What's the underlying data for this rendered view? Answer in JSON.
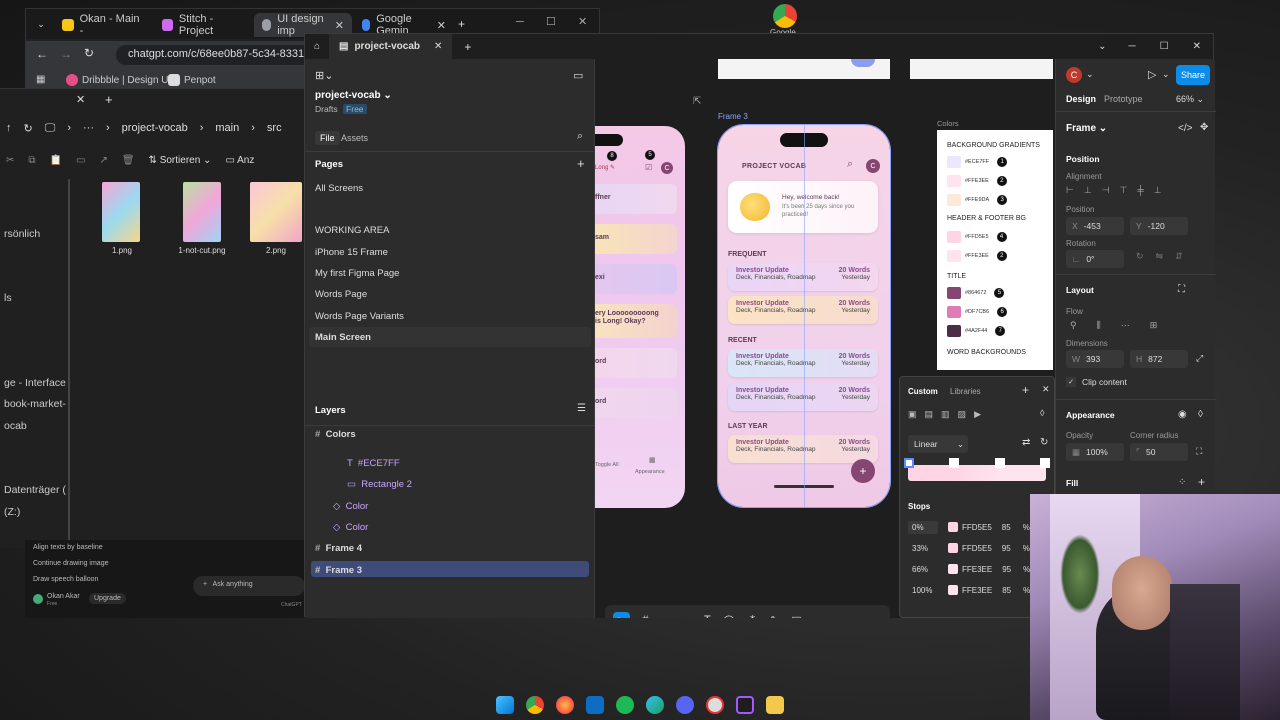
{
  "chrome": {
    "tabs": [
      "Okan - Main -",
      "Stitch - Project",
      "UI design imp",
      "Google Gemin"
    ],
    "url": "chatgpt.com/c/68ee0b87-5c34-8331-9691",
    "bookmarks": [
      "Dribbble | Design U...",
      "Penpot"
    ]
  },
  "desktop": {
    "chrome_label": "Google"
  },
  "explorer": {
    "breadcrumb": [
      "project-vocab",
      "main",
      "src"
    ],
    "sort_label": "Sortieren",
    "view_label": "Anz",
    "files": [
      "1.png",
      "1-not-cut.png",
      "2.png"
    ],
    "sidebar": [
      "rsönlich",
      "ls",
      "ge - Interface D",
      "book-market-a",
      "ocab",
      "Datenträger (C:)",
      "(Z:)"
    ]
  },
  "chatgpt": {
    "items": [
      "Align texts by baseline",
      "Continue drawing image",
      "Draw speech balloon"
    ],
    "user": "Okan Akar",
    "plan": "Free",
    "upgrade": "Upgrade",
    "ask": "Ask anything",
    "brand": "ChatGPT"
  },
  "figma": {
    "tab": "project-vocab",
    "project": {
      "name": "project-vocab",
      "location": "Drafts",
      "badge": "Free"
    },
    "panel_tabs": [
      "File",
      "Assets"
    ],
    "pages_label": "Pages",
    "pages": [
      "All Screens",
      "WORKING AREA",
      "iPhone 15 Frame",
      "My first Figma Page",
      "Words Page",
      "Words Page Variants",
      "Main Screen"
    ],
    "layers_label": "Layers",
    "layers": [
      {
        "name": "Colors",
        "kind": "frame"
      },
      {
        "name": "#ECE7FF",
        "kind": "text"
      },
      {
        "name": "Rectangle 2",
        "kind": "rect"
      },
      {
        "name": "Color",
        "kind": "component"
      },
      {
        "name": "Color",
        "kind": "component"
      },
      {
        "name": "Frame 4",
        "kind": "frame"
      },
      {
        "name": "Frame 3",
        "kind": "frame"
      }
    ],
    "canvas": {
      "frame_label": "Frame 3",
      "colors_label": "Colors",
      "left_phone": {
        "badges": [
          "8",
          "5"
        ],
        "long_label": "Long",
        "words": [
          "ffner",
          "sam",
          "exi",
          "ery Looooooooong\nis Long! Okay?",
          "ord",
          "ord"
        ],
        "toggle": "Toggle All",
        "appearance": "Appearance"
      },
      "phone": {
        "title": "PROJECT VOCAB",
        "welcome": "Hey, welcome back!",
        "days": "It's been 25 days since you practiced!",
        "sections": [
          {
            "title": "FREQUENT",
            "cards": [
              {
                "name": "Investor Update",
                "sub": "Deck, Financials, Roadmap",
                "count": "20 Words",
                "when": "Yesterday"
              },
              {
                "name": "Investor Update",
                "sub": "Deck, Financials, Roadmap",
                "count": "20 Words",
                "when": "Yesterday"
              }
            ]
          },
          {
            "title": "RECENT",
            "cards": [
              {
                "name": "Investor Update",
                "sub": "Deck, Financials, Roadmap",
                "count": "20 Words",
                "when": "Yesterday"
              },
              {
                "name": "Investor Update",
                "sub": "Deck, Financials, Roadmap",
                "count": "20 Words",
                "when": "Yesterday"
              }
            ]
          },
          {
            "title": "LAST YEAR",
            "cards": [
              {
                "name": "Investor Update",
                "sub": "Deck, Financials, Roadmap",
                "count": "20 Words",
                "when": "Yesterday"
              }
            ]
          }
        ],
        "fab": "+"
      },
      "colors_card": {
        "groups": [
          {
            "title": "BACKGROUND GRADIENTS",
            "rows": [
              {
                "hex": "#ECE7FF",
                "color": "#ECE7FF",
                "n": "1"
              },
              {
                "hex": "#FFE3EE",
                "color": "#FFE3EE",
                "n": "2"
              },
              {
                "hex": "#FFE9DA",
                "color": "#FFE9DA",
                "n": "3"
              }
            ]
          },
          {
            "title": "HEADER & FOOTER BG",
            "rows": [
              {
                "hex": "#FFD5E5",
                "color": "#FFD5E5",
                "n": "4"
              },
              {
                "hex": "#FFE3EE",
                "color": "#FFE3EE",
                "n": "2"
              }
            ]
          },
          {
            "title": "TITLE",
            "rows": [
              {
                "hex": "#864672",
                "color": "#864672",
                "n": "5"
              },
              {
                "hex": "#DF7CB6",
                "color": "#DF7CB6",
                "n": "6"
              },
              {
                "hex": "#4A2F44",
                "color": "#4A2F44",
                "n": "7"
              }
            ]
          },
          {
            "title": "WORD BACKGROUNDS",
            "rows": []
          }
        ]
      },
      "picker": {
        "tabs": [
          "Custom",
          "Libraries"
        ],
        "type": "Linear",
        "stops_label": "Stops",
        "stops": [
          {
            "pos": "0%",
            "hex": "FFD5E5",
            "opacity": "85",
            "unit": "%"
          },
          {
            "pos": "33%",
            "hex": "FFD5E5",
            "opacity": "95",
            "unit": "%"
          },
          {
            "pos": "66%",
            "hex": "FFE3EE",
            "opacity": "95",
            "unit": "%"
          },
          {
            "pos": "100%",
            "hex": "FFE3EE",
            "opacity": "85",
            "unit": "%"
          }
        ]
      }
    },
    "right": {
      "avatar": "C",
      "share": "Share",
      "tabs": [
        "Design",
        "Prototype"
      ],
      "zoom": "66%",
      "frame_label": "Frame",
      "position": "Position",
      "alignment": "Alignment",
      "position_sub": "Position",
      "x": "-453",
      "y": "-120",
      "rotation": "Rotation",
      "rot_val": "0°",
      "layout": "Layout",
      "flow": "Flow",
      "dimensions": "Dimensions",
      "w": "393",
      "h": "872",
      "clip": "Clip content",
      "appearance": "Appearance",
      "opacity_label": "Opacity",
      "opacity": "100%",
      "radius_label": "Corner radius",
      "radius": "50",
      "fill": "Fill"
    }
  },
  "taskbar": [
    "windows",
    "chrome",
    "firefox",
    "vscode",
    "spotify",
    "edge",
    "discord",
    "app",
    "figma",
    "files"
  ]
}
